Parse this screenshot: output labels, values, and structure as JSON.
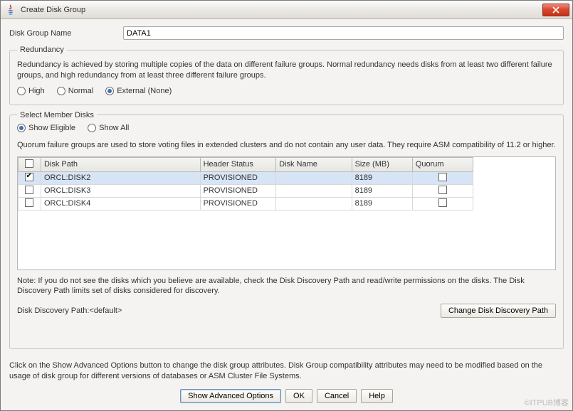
{
  "titlebar": {
    "title": "Create Disk Group"
  },
  "diskGroupName": {
    "label": "Disk Group Name",
    "value": "DATA1"
  },
  "redundancy": {
    "legend": "Redundancy",
    "desc": "Redundancy is achieved by storing multiple copies of the data on different failure groups. Normal redundancy needs disks from at least two different failure groups, and high redundancy from at least three different failure groups.",
    "options": {
      "high": "High",
      "normal": "Normal",
      "external": "External (None)"
    },
    "selected": "external"
  },
  "memberDisks": {
    "legend": "Select Member Disks",
    "filterOptions": {
      "eligible": "Show Eligible",
      "all": "Show All"
    },
    "filterSelected": "eligible",
    "quorumDesc": "Quorum failure groups are used to store voting files in extended clusters and do not contain any user data. They require ASM compatibility of 11.2 or higher.",
    "headers": {
      "diskPath": "Disk Path",
      "headerStatus": "Header Status",
      "diskName": "Disk Name",
      "sizeMB": "Size (MB)",
      "quorum": "Quorum"
    },
    "rows": [
      {
        "checked": true,
        "diskPath": "ORCL:DISK2",
        "headerStatus": "PROVISIONED",
        "diskName": "",
        "sizeMB": "8189",
        "quorum": false
      },
      {
        "checked": false,
        "diskPath": "ORCL:DISK3",
        "headerStatus": "PROVISIONED",
        "diskName": "",
        "sizeMB": "8189",
        "quorum": false
      },
      {
        "checked": false,
        "diskPath": "ORCL:DISK4",
        "headerStatus": "PROVISIONED",
        "diskName": "",
        "sizeMB": "8189",
        "quorum": false
      }
    ],
    "note": "Note: If you do not see the disks which you believe are available, check the Disk Discovery Path and read/write permissions on the disks. The Disk Discovery Path limits set of disks considered for discovery.",
    "discoveryLabel": "Disk Discovery Path:",
    "discoveryValue": "<default>",
    "changePathBtn": "Change Disk Discovery Path"
  },
  "bottomText": "Click on the Show Advanced Options button to change the disk group attributes. Disk Group compatibility attributes may need to be modified based on the usage of disk group for different versions of databases or ASM Cluster File Systems.",
  "buttons": {
    "advanced": "Show Advanced Options",
    "ok": "OK",
    "cancel": "Cancel",
    "help": "Help"
  },
  "watermark": "©ITPUB博客"
}
